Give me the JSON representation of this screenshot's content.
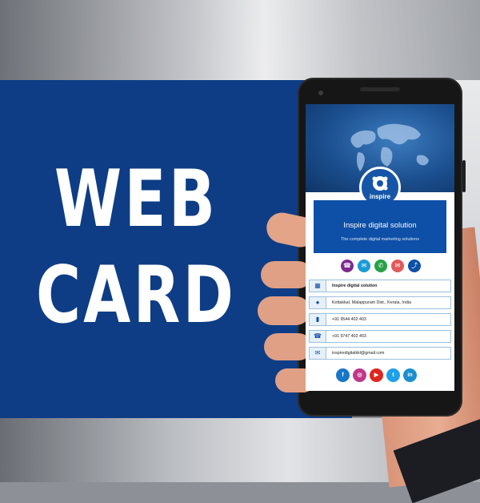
{
  "banner": {
    "title_line1": "WEB",
    "title_line2": "CARD"
  },
  "card": {
    "logo_text": "inspire",
    "company_name": "Inspire digital solution",
    "tagline": "The complete digital marketing solutions",
    "actions": [
      {
        "icon": "phone-icon",
        "color": "#7b2a8e"
      },
      {
        "icon": "sms-icon",
        "color": "#1a9ad6"
      },
      {
        "icon": "whatsapp-icon",
        "color": "#25a244"
      },
      {
        "icon": "email-icon",
        "color": "#e05b5b"
      },
      {
        "icon": "share-icon",
        "color": "#0e4fa7"
      }
    ],
    "details": [
      {
        "icon": "building-icon",
        "text": "Inspire digital solution",
        "bold": true
      },
      {
        "icon": "map-pin-icon",
        "text": "Kottakkal, Malappuram Dist., Kerala, India"
      },
      {
        "icon": "mobile-icon",
        "text": "+91 9544 402 403"
      },
      {
        "icon": "phone-icon",
        "text": "+91 9747 402 403"
      },
      {
        "icon": "envelope-icon",
        "text": "inspiredigitalkkl@gmail.com"
      }
    ],
    "social": [
      {
        "icon": "facebook-icon",
        "glyph": "f",
        "color": "#1877c9"
      },
      {
        "icon": "instagram-icon",
        "glyph": "◎",
        "color": "#c0378a"
      },
      {
        "icon": "youtube-icon",
        "glyph": "▶",
        "color": "#e0261e"
      },
      {
        "icon": "twitter-icon",
        "glyph": "t",
        "color": "#1ea1e8"
      },
      {
        "icon": "linkedin-icon",
        "glyph": "in",
        "color": "#1a8fce"
      }
    ]
  }
}
